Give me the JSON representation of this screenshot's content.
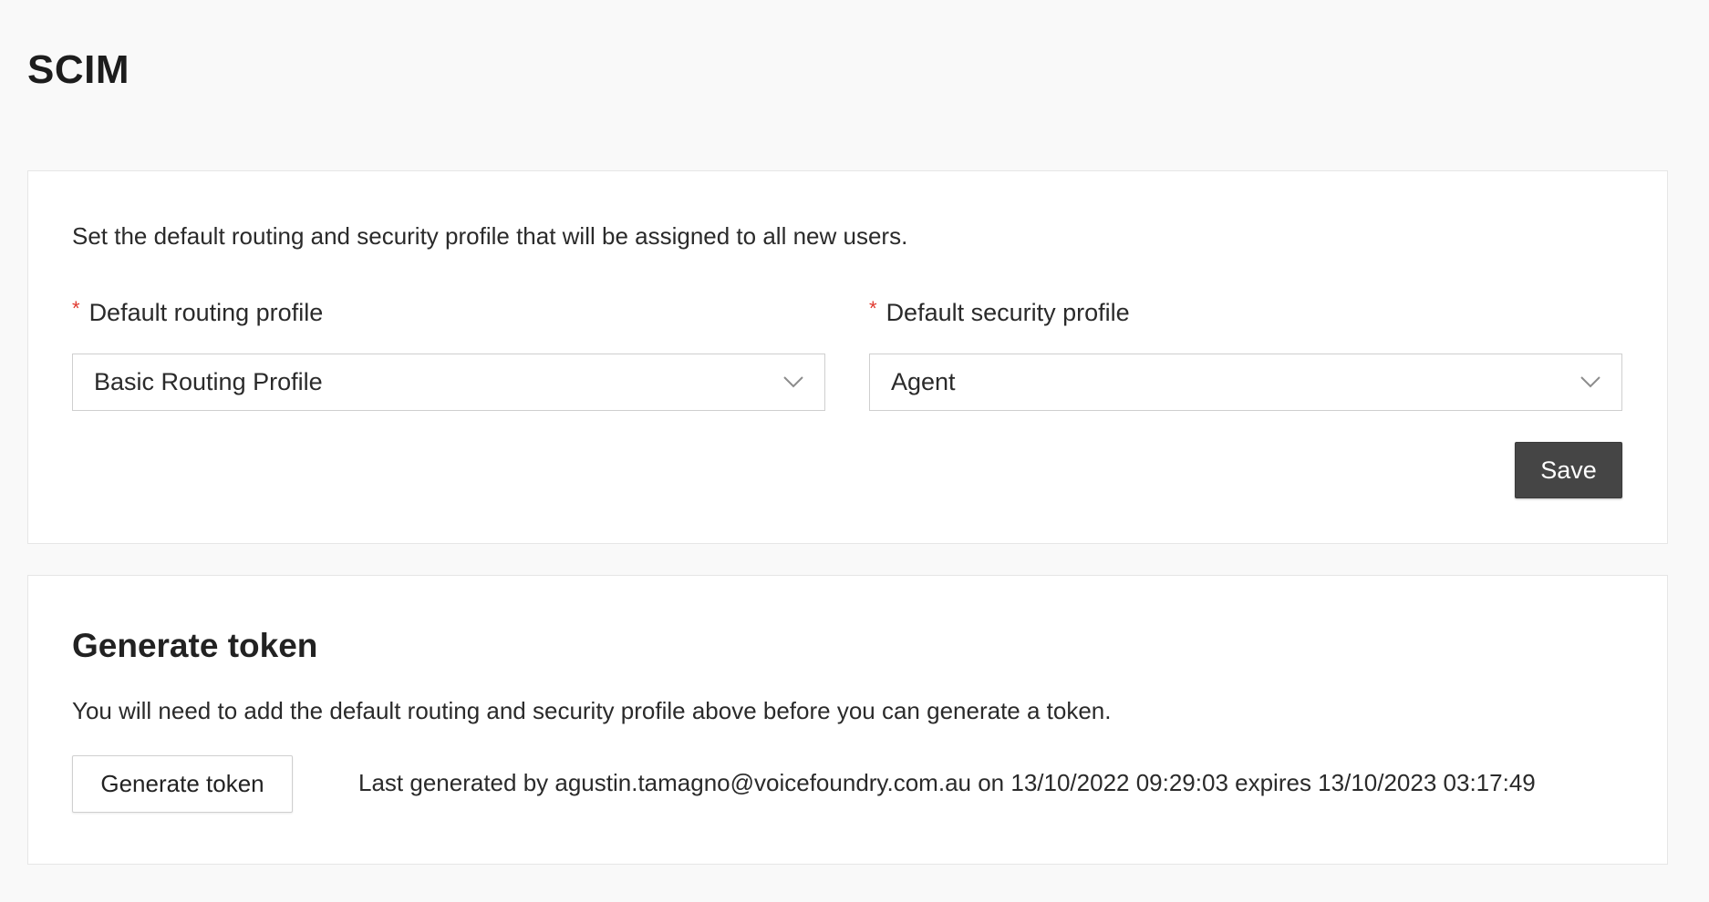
{
  "page": {
    "title": "SCIM"
  },
  "profiles_card": {
    "intro": "Set the default routing and security profile that will be assigned to all new users.",
    "required_marker": "*",
    "routing": {
      "label": "Default routing profile",
      "value": "Basic Routing Profile"
    },
    "security": {
      "label": "Default security profile",
      "value": "Agent"
    },
    "save_label": "Save"
  },
  "token_card": {
    "title": "Generate token",
    "note": "You will need to add the default routing and security profile above before you can generate a token.",
    "button_label": "Generate token",
    "last_generated": "Last generated by agustin.tamagno@voicefoundry.com.au on 13/10/2022 09:29:03 expires 13/10/2023 03:17:49"
  },
  "icons": {
    "dropdown": "chevron-down-icon"
  },
  "colors": {
    "required": "#e0392f",
    "primary_button": "#454545"
  }
}
